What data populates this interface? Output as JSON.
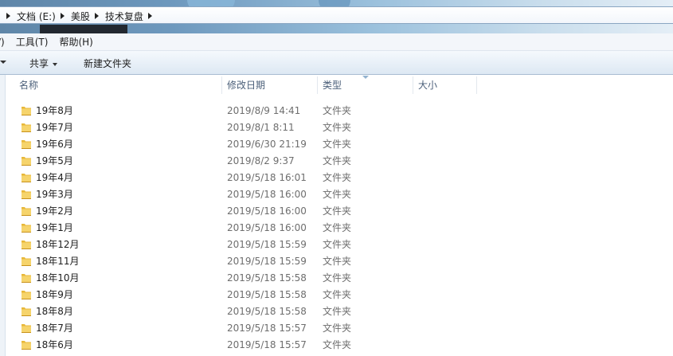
{
  "address_bar": {
    "crumbs": [
      "文档 (E:)",
      "美股",
      "技术复盘"
    ]
  },
  "menu": {
    "items": [
      "/)",
      "工具(T)",
      "帮助(H)"
    ]
  },
  "toolbar": {
    "share_label": "共享",
    "new_folder_label": "新建文件夹"
  },
  "columns": {
    "name": "名称",
    "date": "修改日期",
    "type": "类型",
    "size": "大小"
  },
  "icons": {
    "folder": "folder-icon",
    "crumb_separator": "chevron-right-icon",
    "share_dropdown": "chevron-down-icon"
  },
  "files": [
    {
      "name": "19年8月",
      "date": "2019/8/9 14:41",
      "type": "文件夹"
    },
    {
      "name": "19年7月",
      "date": "2019/8/1 8:11",
      "type": "文件夹"
    },
    {
      "name": "19年6月",
      "date": "2019/6/30 21:19",
      "type": "文件夹"
    },
    {
      "name": "19年5月",
      "date": "2019/8/2 9:37",
      "type": "文件夹"
    },
    {
      "name": "19年4月",
      "date": "2019/5/18 16:01",
      "type": "文件夹"
    },
    {
      "name": "19年3月",
      "date": "2019/5/18 16:00",
      "type": "文件夹"
    },
    {
      "name": "19年2月",
      "date": "2019/5/18 16:00",
      "type": "文件夹"
    },
    {
      "name": "19年1月",
      "date": "2019/5/18 16:00",
      "type": "文件夹"
    },
    {
      "name": "18年12月",
      "date": "2019/5/18 15:59",
      "type": "文件夹"
    },
    {
      "name": "18年11月",
      "date": "2019/5/18 15:59",
      "type": "文件夹"
    },
    {
      "name": "18年10月",
      "date": "2019/5/18 15:58",
      "type": "文件夹"
    },
    {
      "name": "18年9月",
      "date": "2019/5/18 15:58",
      "type": "文件夹"
    },
    {
      "name": "18年8月",
      "date": "2019/5/18 15:58",
      "type": "文件夹"
    },
    {
      "name": "18年7月",
      "date": "2019/5/18 15:57",
      "type": "文件夹"
    },
    {
      "name": "18年6月",
      "date": "2019/5/18 15:57",
      "type": "文件夹"
    }
  ]
}
